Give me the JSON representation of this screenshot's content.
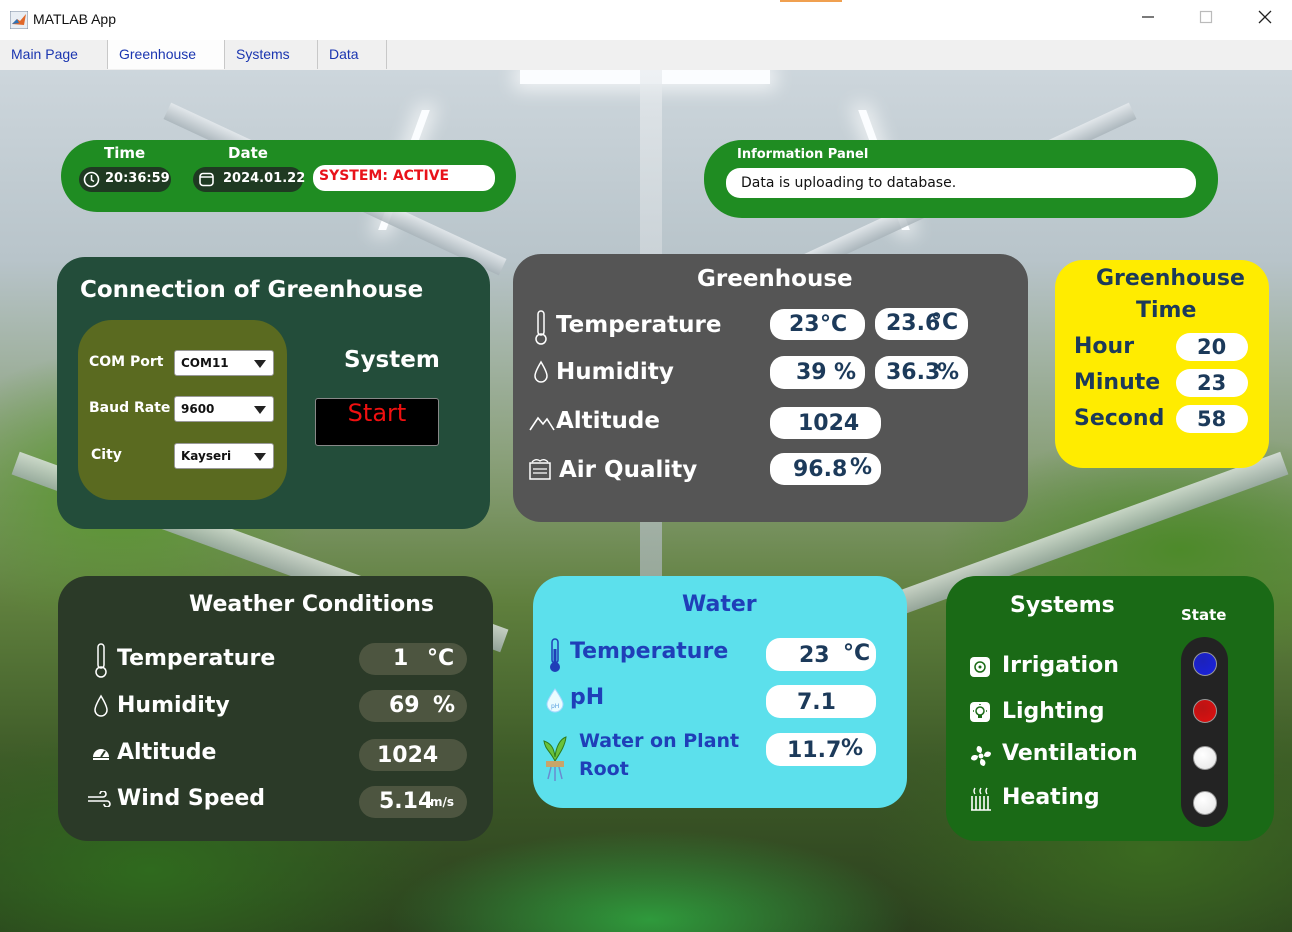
{
  "window": {
    "title": "MATLAB App"
  },
  "tabs": [
    {
      "label": "Main Page"
    },
    {
      "label": "Greenhouse"
    },
    {
      "label": "Systems"
    },
    {
      "label": "Data"
    }
  ],
  "top_status": {
    "time_label": "Time",
    "time_value": "20:36:59",
    "date_label": "Date",
    "date_value": "2024.01.22",
    "system_status": "SYSTEM: ACTIVE"
  },
  "info_panel": {
    "title": "Information Panel",
    "message": "Data is uploading to database."
  },
  "connection": {
    "title": "Connection of Greenhouse",
    "com_port_label": "COM Port",
    "com_port_value": "COM11",
    "baud_rate_label": "Baud Rate",
    "baud_rate_value": "9600",
    "city_label": "City",
    "city_value": "Kayseri",
    "system_label": "System",
    "start_button": "Start"
  },
  "greenhouse": {
    "title": "Greenhouse",
    "temperature_label": "Temperature",
    "temperature_value_1": "23",
    "temperature_unit_1": "°C",
    "temperature_value_2": "23.6",
    "temperature_unit_2": "°C",
    "humidity_label": "Humidity",
    "humidity_value_1": "39",
    "humidity_unit_1": "%",
    "humidity_value_2": "36.3",
    "humidity_unit_2": "%",
    "altitude_label": "Altitude",
    "altitude_value": "1024",
    "air_quality_label": "Air Quality",
    "air_quality_value": "96.8",
    "air_quality_unit": "%"
  },
  "greenhouse_time": {
    "title_line1": "Greenhouse",
    "title_line2": "Time",
    "hour_label": "Hour",
    "hour_value": "20",
    "minute_label": "Minute",
    "minute_value": "23",
    "second_label": "Second",
    "second_value": "58"
  },
  "weather": {
    "title": "Weather Conditions",
    "temperature_label": "Temperature",
    "temperature_value": "1",
    "temperature_unit": "°C",
    "humidity_label": "Humidity",
    "humidity_value": "69",
    "humidity_unit": "%",
    "altitude_label": "Altitude",
    "altitude_value": "1024",
    "wind_label": "Wind Speed",
    "wind_value": "5.14",
    "wind_unit": "m/s"
  },
  "water": {
    "title": "Water",
    "temperature_label": "Temperature",
    "temperature_value": "23",
    "temperature_unit": "°C",
    "ph_label": "pH",
    "ph_value": "7.1",
    "plant_root_label_line1": "Water on Plant",
    "plant_root_label_line2": "Root",
    "plant_root_value": "11.7",
    "plant_root_unit": "%"
  },
  "systems": {
    "title": "Systems",
    "state_label": "State",
    "items": [
      {
        "label": "Irrigation",
        "state_color": "#1a22e0"
      },
      {
        "label": "Lighting",
        "state_color": "#e01010"
      },
      {
        "label": "Ventilation",
        "state_color": "#ffffff"
      },
      {
        "label": "Heating",
        "state_color": "#ffffff"
      }
    ]
  },
  "colors": {
    "status_green": "#1f8c22",
    "connection_bg": "#234d3a",
    "greenhouse_bg": "#555555",
    "time_bg": "#ffec00",
    "weather_bg": "#2b3a28",
    "water_bg": "#5ce0ec",
    "systems_bg": "#1a6a16"
  }
}
